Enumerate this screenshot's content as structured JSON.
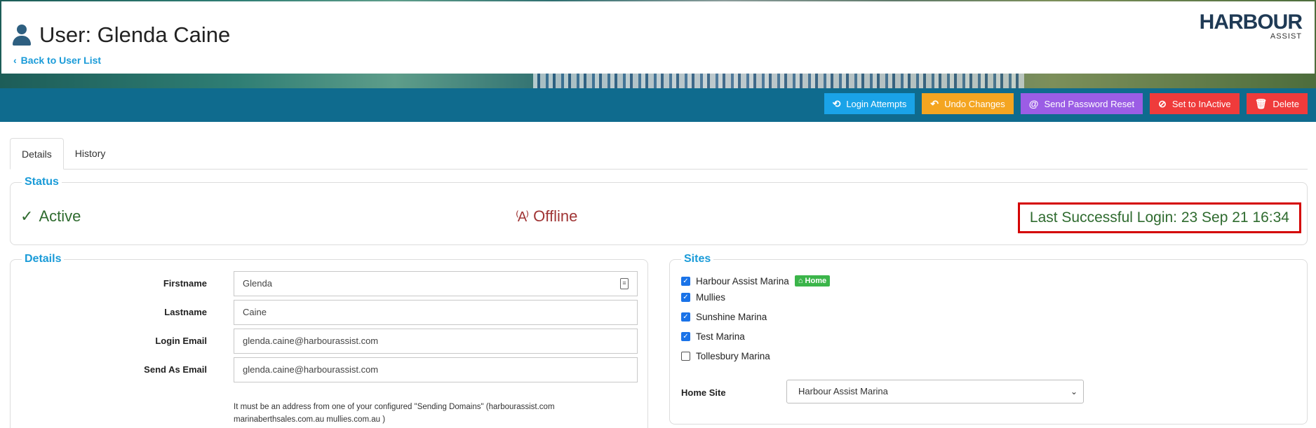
{
  "header": {
    "title": "User: Glenda Caine",
    "back_link": "Back to User List",
    "logo_brand": "HARBOUR",
    "logo_sub": "ASSIST"
  },
  "toolbar": {
    "buttons": [
      {
        "label": "Login Attempts",
        "icon": "history-icon",
        "color": "#1aa3e8"
      },
      {
        "label": "Undo Changes",
        "icon": "undo-icon",
        "color": "#f4a521"
      },
      {
        "label": "Send Password Reset",
        "icon": "at-icon",
        "color": "#9b5de5"
      },
      {
        "label": "Set to InActive",
        "icon": "ban-icon",
        "color": "#ef3b3b"
      },
      {
        "label": "Delete",
        "icon": "trash-icon",
        "color": "#ef3b3b"
      }
    ]
  },
  "tabs": [
    {
      "label": "Details",
      "active": true
    },
    {
      "label": "History",
      "active": false
    }
  ],
  "status": {
    "legend": "Status",
    "active": "Active",
    "offline": "Offline",
    "last_login": "Last Successful Login: 23 Sep 21 16:34"
  },
  "details": {
    "legend": "Details",
    "fields": [
      {
        "label": "Firstname",
        "value": "Glenda"
      },
      {
        "label": "Lastname",
        "value": "Caine"
      },
      {
        "label": "Login Email",
        "value": "glenda.caine@harbourassist.com"
      },
      {
        "label": "Send As Email",
        "value": "glenda.caine@harbourassist.com"
      }
    ],
    "help": "It must be an address from one of your configured \"Sending Domains\" (harbourassist.com marinaberthsales.com.au mullies.com.au )"
  },
  "sites": {
    "legend": "Sites",
    "items": [
      {
        "label": "Harbour Assist Marina",
        "checked": true,
        "badge": "Home"
      },
      {
        "label": "Mullies",
        "checked": true
      },
      {
        "label": "Sunshine Marina",
        "checked": true
      },
      {
        "label": "Test Marina",
        "checked": true
      },
      {
        "label": "Tollesbury Marina",
        "checked": false
      }
    ],
    "home_site_label": "Home Site",
    "home_site_value": "Harbour Assist Marina"
  }
}
